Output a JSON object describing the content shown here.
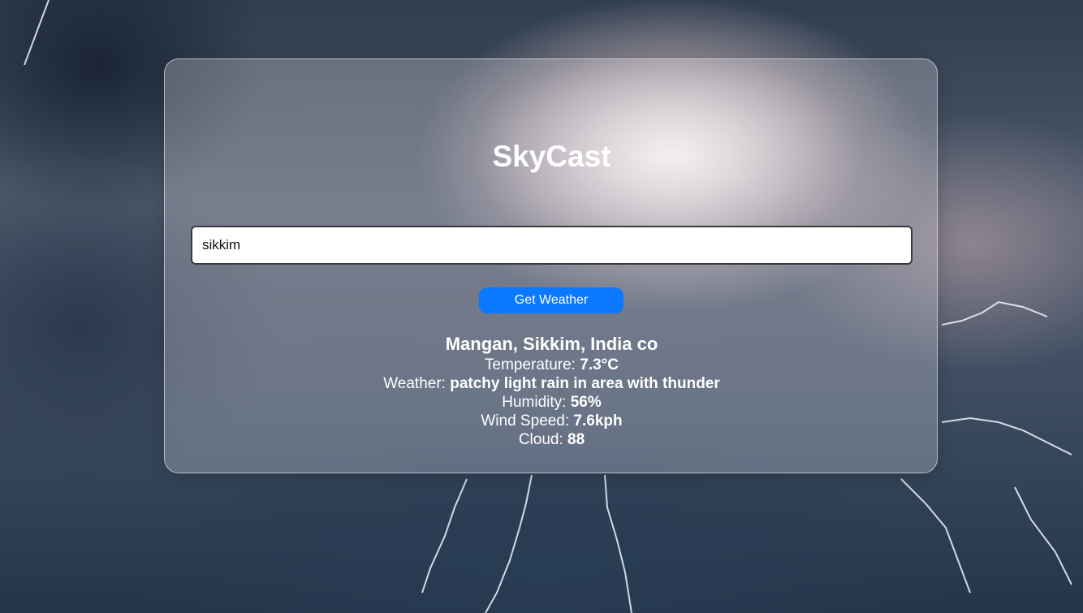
{
  "app": {
    "title": "SkyCast"
  },
  "search": {
    "value": "sikkim"
  },
  "actions": {
    "get_weather_label": "Get Weather"
  },
  "weather": {
    "location": "Mangan, Sikkim, India co",
    "temperature_label": "Temperature:",
    "temperature_value": "7.3°C",
    "condition_label": "Weather:",
    "condition_value": "patchy light rain in area with thunder",
    "humidity_label": "Humidity:",
    "humidity_value": "56%",
    "wind_label": "Wind Speed:",
    "wind_value": "7.6kph",
    "cloud_label": "Cloud:",
    "cloud_value": "88"
  },
  "theme": {
    "button_color": "#0a78ff",
    "text_color": "#ffffff"
  }
}
